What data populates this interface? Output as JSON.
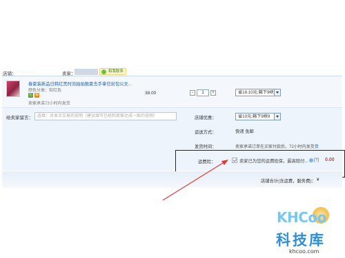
{
  "store": {
    "store_label": "店铺：",
    "store_name": "···········",
    "seller_label": "卖家：",
    "wangwang_label": "和我联系"
  },
  "item": {
    "title": "春夏装新品日韩红黑时尚拍拍数夏去手拿信封包公文...",
    "color": "颜色分类：软红色",
    "badge1": "七",
    "badge2": "保",
    "promise": "卖家承诺72小时内发货",
    "price": "38.00",
    "qty_minus": "-",
    "qty": "1",
    "qty_plus": "+",
    "coupon": "省18.10元:箱下9峡9"
  },
  "message": {
    "label": "给卖家留言：",
    "placeholder": "选填：对本次交易的说明（建议填写已经和卖家达成一致的说明）"
  },
  "store_discount": {
    "label": "店铺优惠：",
    "value": "省10元:箱下9峡9"
  },
  "shipping": {
    "label": "运送方式：",
    "value": "快递 免邮"
  },
  "send_time": {
    "label": "发货时间：",
    "value": "卖家承诺订单在买家付款后，72小时内发货",
    "link": "货"
  },
  "insurance": {
    "label": "运费险：",
    "text": "卖家已为您的运费投保，最高赔付...",
    "help": "[?]",
    "price": "0.00"
  },
  "total": {
    "label": "店铺合计(含运费，服务费)：",
    "value": "¥"
  },
  "watermark": {
    "logo": "KHCoo",
    "cn": "科技库",
    "url": "khcoo.com"
  },
  "colors": {
    "accent_link": "#1f5fb4",
    "price_red": "#e4393c",
    "panel_bg": "#eef4fb"
  }
}
